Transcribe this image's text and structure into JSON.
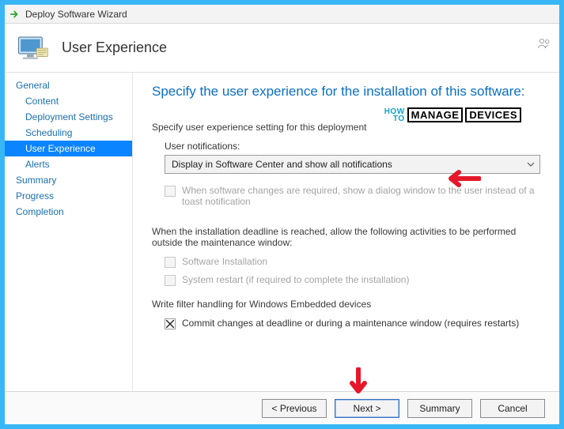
{
  "window": {
    "title": "Deploy Software Wizard"
  },
  "header": {
    "page_title": "User Experience"
  },
  "sidebar": {
    "items": [
      {
        "label": "General",
        "sub": false,
        "selected": false
      },
      {
        "label": "Content",
        "sub": true,
        "selected": false
      },
      {
        "label": "Deployment Settings",
        "sub": true,
        "selected": false
      },
      {
        "label": "Scheduling",
        "sub": true,
        "selected": false
      },
      {
        "label": "User Experience",
        "sub": true,
        "selected": true
      },
      {
        "label": "Alerts",
        "sub": true,
        "selected": false
      },
      {
        "label": "Summary",
        "sub": false,
        "selected": false
      },
      {
        "label": "Progress",
        "sub": false,
        "selected": false
      },
      {
        "label": "Completion",
        "sub": false,
        "selected": false
      }
    ]
  },
  "content": {
    "heading": "Specify the user experience for the installation of this software:",
    "section_intro": "Specify user experience setting for this deployment",
    "notif_label": "User notifications:",
    "notif_value": "Display in Software Center and show all notifications",
    "toast_cb": "When software changes are required, show a dialog window to the user instead of a toast notification",
    "deadline_intro": "When the installation deadline is reached, allow the following activities to be performed outside the maintenance window:",
    "cb_install": "Software Installation",
    "cb_restart": "System restart  (if required to complete the installation)",
    "embedded_label": "Write filter handling for Windows Embedded devices",
    "cb_commit": "Commit changes at deadline or during a maintenance window (requires restarts)"
  },
  "watermark": {
    "how": "HOW",
    "to": "TO",
    "manage": "MANAGE",
    "devices": "DEVICES"
  },
  "footer": {
    "previous": "< Previous",
    "next": "Next >",
    "summary": "Summary",
    "cancel": "Cancel"
  }
}
